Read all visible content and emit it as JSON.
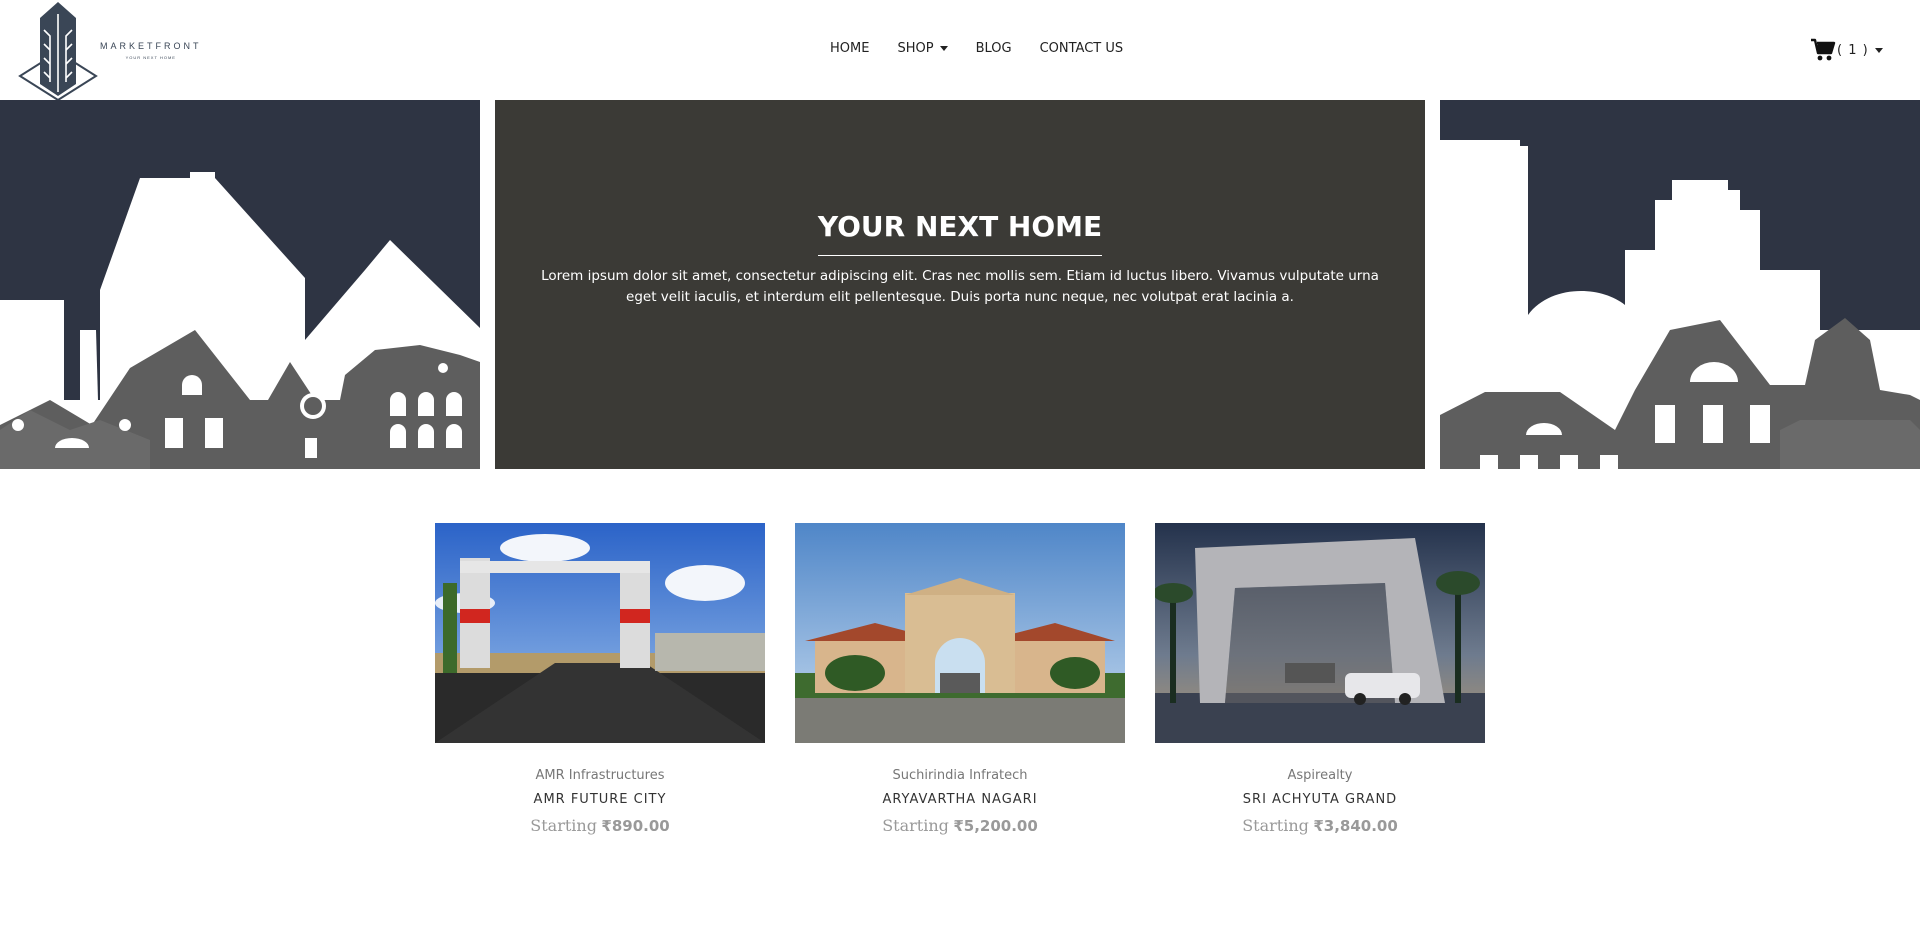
{
  "brand": {
    "name": "MARKETFRONT",
    "tagline": "YOUR NEXT HOME"
  },
  "nav": {
    "home": "HOME",
    "shop": "SHOP",
    "blog": "BLOG",
    "contact": "CONTACT US"
  },
  "cart": {
    "count": "( 1 )"
  },
  "hero": {
    "title": "YOUR NEXT HOME",
    "text": "Lorem ipsum dolor sit amet, consectetur adipiscing elit. Cras nec mollis sem. Etiam id luctus libero. Vivamus vulputate urna eget velit iaculis, et interdum elit pellentesque. Duis porta nunc neque, nec volutpat erat lacinia a."
  },
  "products": [
    {
      "vendor": "AMR Infrastructures",
      "name": "AMR FUTURE CITY",
      "starting": "Starting",
      "price": "₹890.00"
    },
    {
      "vendor": "Suchirindia Infratech",
      "name": "ARYAVARTHA NAGARI",
      "starting": "Starting",
      "price": "₹5,200.00"
    },
    {
      "vendor": "Aspirealty",
      "name": "SRI ACHYUTA GRAND",
      "starting": "Starting",
      "price": "₹3,840.00"
    }
  ],
  "colors": {
    "hero_bg": "#3b3a36",
    "sky": "#2e3443",
    "house": "#5e5e5e",
    "brand": "#3a4656"
  }
}
